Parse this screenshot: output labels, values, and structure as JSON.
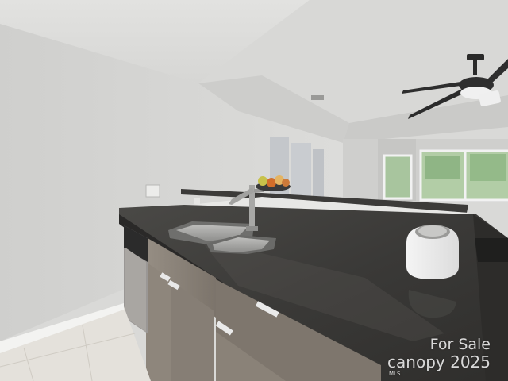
{
  "watermark": {
    "line1": "For Sale",
    "line2": "canopy 2025",
    "line3": "MLS"
  },
  "palette": {
    "wall": "#d4d4d2",
    "ceiling": "#dededc",
    "granite": "#3f3e3c",
    "cabinet": "#8b8379",
    "floor": "#e4e1db",
    "window_glass": "#a8c59e"
  },
  "objects": [
    "ceiling-fan",
    "kitchen-sink",
    "faucet",
    "fruit-bowl",
    "electric-kettle",
    "dishwasher",
    "cabinets",
    "windows",
    "wall-art-panels",
    "light-switch",
    "power-outlet"
  ]
}
